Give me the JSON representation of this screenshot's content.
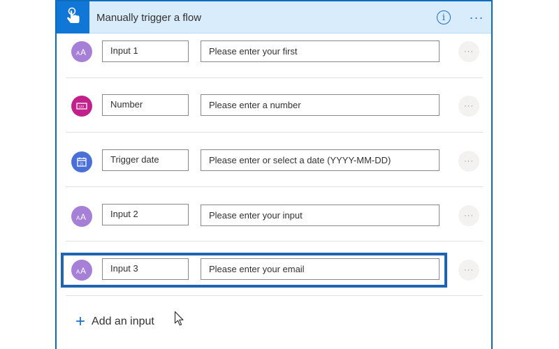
{
  "header": {
    "title": "Manually trigger a flow",
    "trigger_icon": "touch-hand-icon",
    "info_icon": "info-icon",
    "info_glyph": "i",
    "menu_icon": "more-horizontal-icon",
    "menu_glyph": "···",
    "tile_color": "#1177d6"
  },
  "inputs": [
    {
      "type_icon": "text-aa-icon",
      "icon_color": "#a67fd6",
      "name": "Input 1",
      "placeholder": "Please enter your first"
    },
    {
      "type_icon": "number-icon",
      "icon_color": "#c2218b",
      "name": "Number",
      "placeholder": "Please enter a number"
    },
    {
      "type_icon": "calendar-icon",
      "icon_color": "#4a6fd6",
      "name": "Trigger date",
      "placeholder": "Please enter or select a date (YYYY-MM-DD)"
    },
    {
      "type_icon": "text-aa-icon",
      "icon_color": "#a67fd6",
      "name": "Input 2",
      "placeholder": "Please enter your input"
    },
    {
      "type_icon": "text-aa-icon",
      "icon_color": "#a67fd6",
      "name": "Input 3",
      "placeholder": "Please enter your email"
    }
  ],
  "row_more_glyph": "···",
  "add_input": {
    "icon": "plus-icon",
    "glyph": "+",
    "label": "Add an input"
  },
  "highlight_color": "#1e64b0"
}
